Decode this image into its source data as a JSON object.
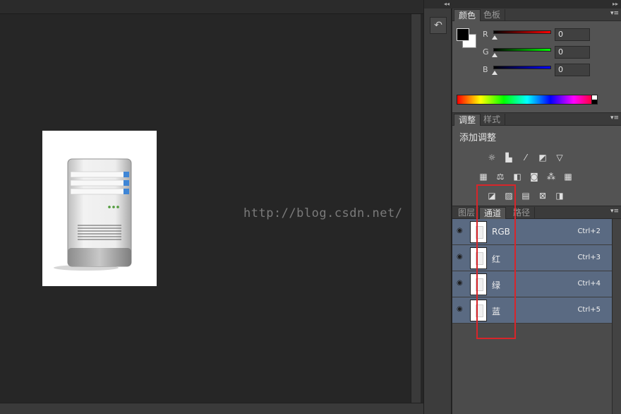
{
  "canvas": {
    "watermark": "http://blog.csdn.net/"
  },
  "mid_strip": {
    "collapse_icon": "double-chevron-left-icon",
    "history_icon": "history-brush-icon"
  },
  "panels": {
    "collapse_icon": "double-chevron-right-icon",
    "color": {
      "tabs": [
        "颜色",
        "色板"
      ],
      "active_tab": 0,
      "foreground": "#000000",
      "background": "#ffffff",
      "channels": [
        {
          "label": "R",
          "value": "0",
          "gradient": [
            "#000000",
            "#ff0000"
          ]
        },
        {
          "label": "G",
          "value": "0",
          "gradient": [
            "#000000",
            "#00ff00"
          ]
        },
        {
          "label": "B",
          "value": "0",
          "gradient": [
            "#000000",
            "#0000ff"
          ]
        }
      ]
    },
    "adjustments": {
      "tabs": [
        "调整",
        "样式"
      ],
      "active_tab": 0,
      "title": "添加调整",
      "icons": [
        "brightness-contrast-icon",
        "levels-icon",
        "curves-icon",
        "exposure-icon",
        "vibrance-icon",
        "hue-saturation-icon",
        "color-balance-icon",
        "black-white-icon",
        "photo-filter-icon",
        "channel-mixer-icon",
        "color-lookup-icon",
        "invert-icon",
        "posterize-icon",
        "threshold-icon",
        "gradient-map-icon"
      ]
    },
    "channels_panel": {
      "tabs": [
        "图层",
        "通道",
        "路径"
      ],
      "active_tab": 1,
      "rows": [
        {
          "name": "RGB",
          "shortcut": "Ctrl+2"
        },
        {
          "name": "红",
          "shortcut": "Ctrl+3"
        },
        {
          "name": "绿",
          "shortcut": "Ctrl+4"
        },
        {
          "name": "蓝",
          "shortcut": "Ctrl+5"
        }
      ],
      "footer_icons": [
        "load-selection-icon",
        "save-selection-icon",
        "new-channel-icon",
        "delete-channel-icon"
      ]
    }
  },
  "colors": {
    "selected_row": "#5a6a82",
    "highlight": "#d8252a",
    "panel": "#535353",
    "canvas": "#262626"
  }
}
